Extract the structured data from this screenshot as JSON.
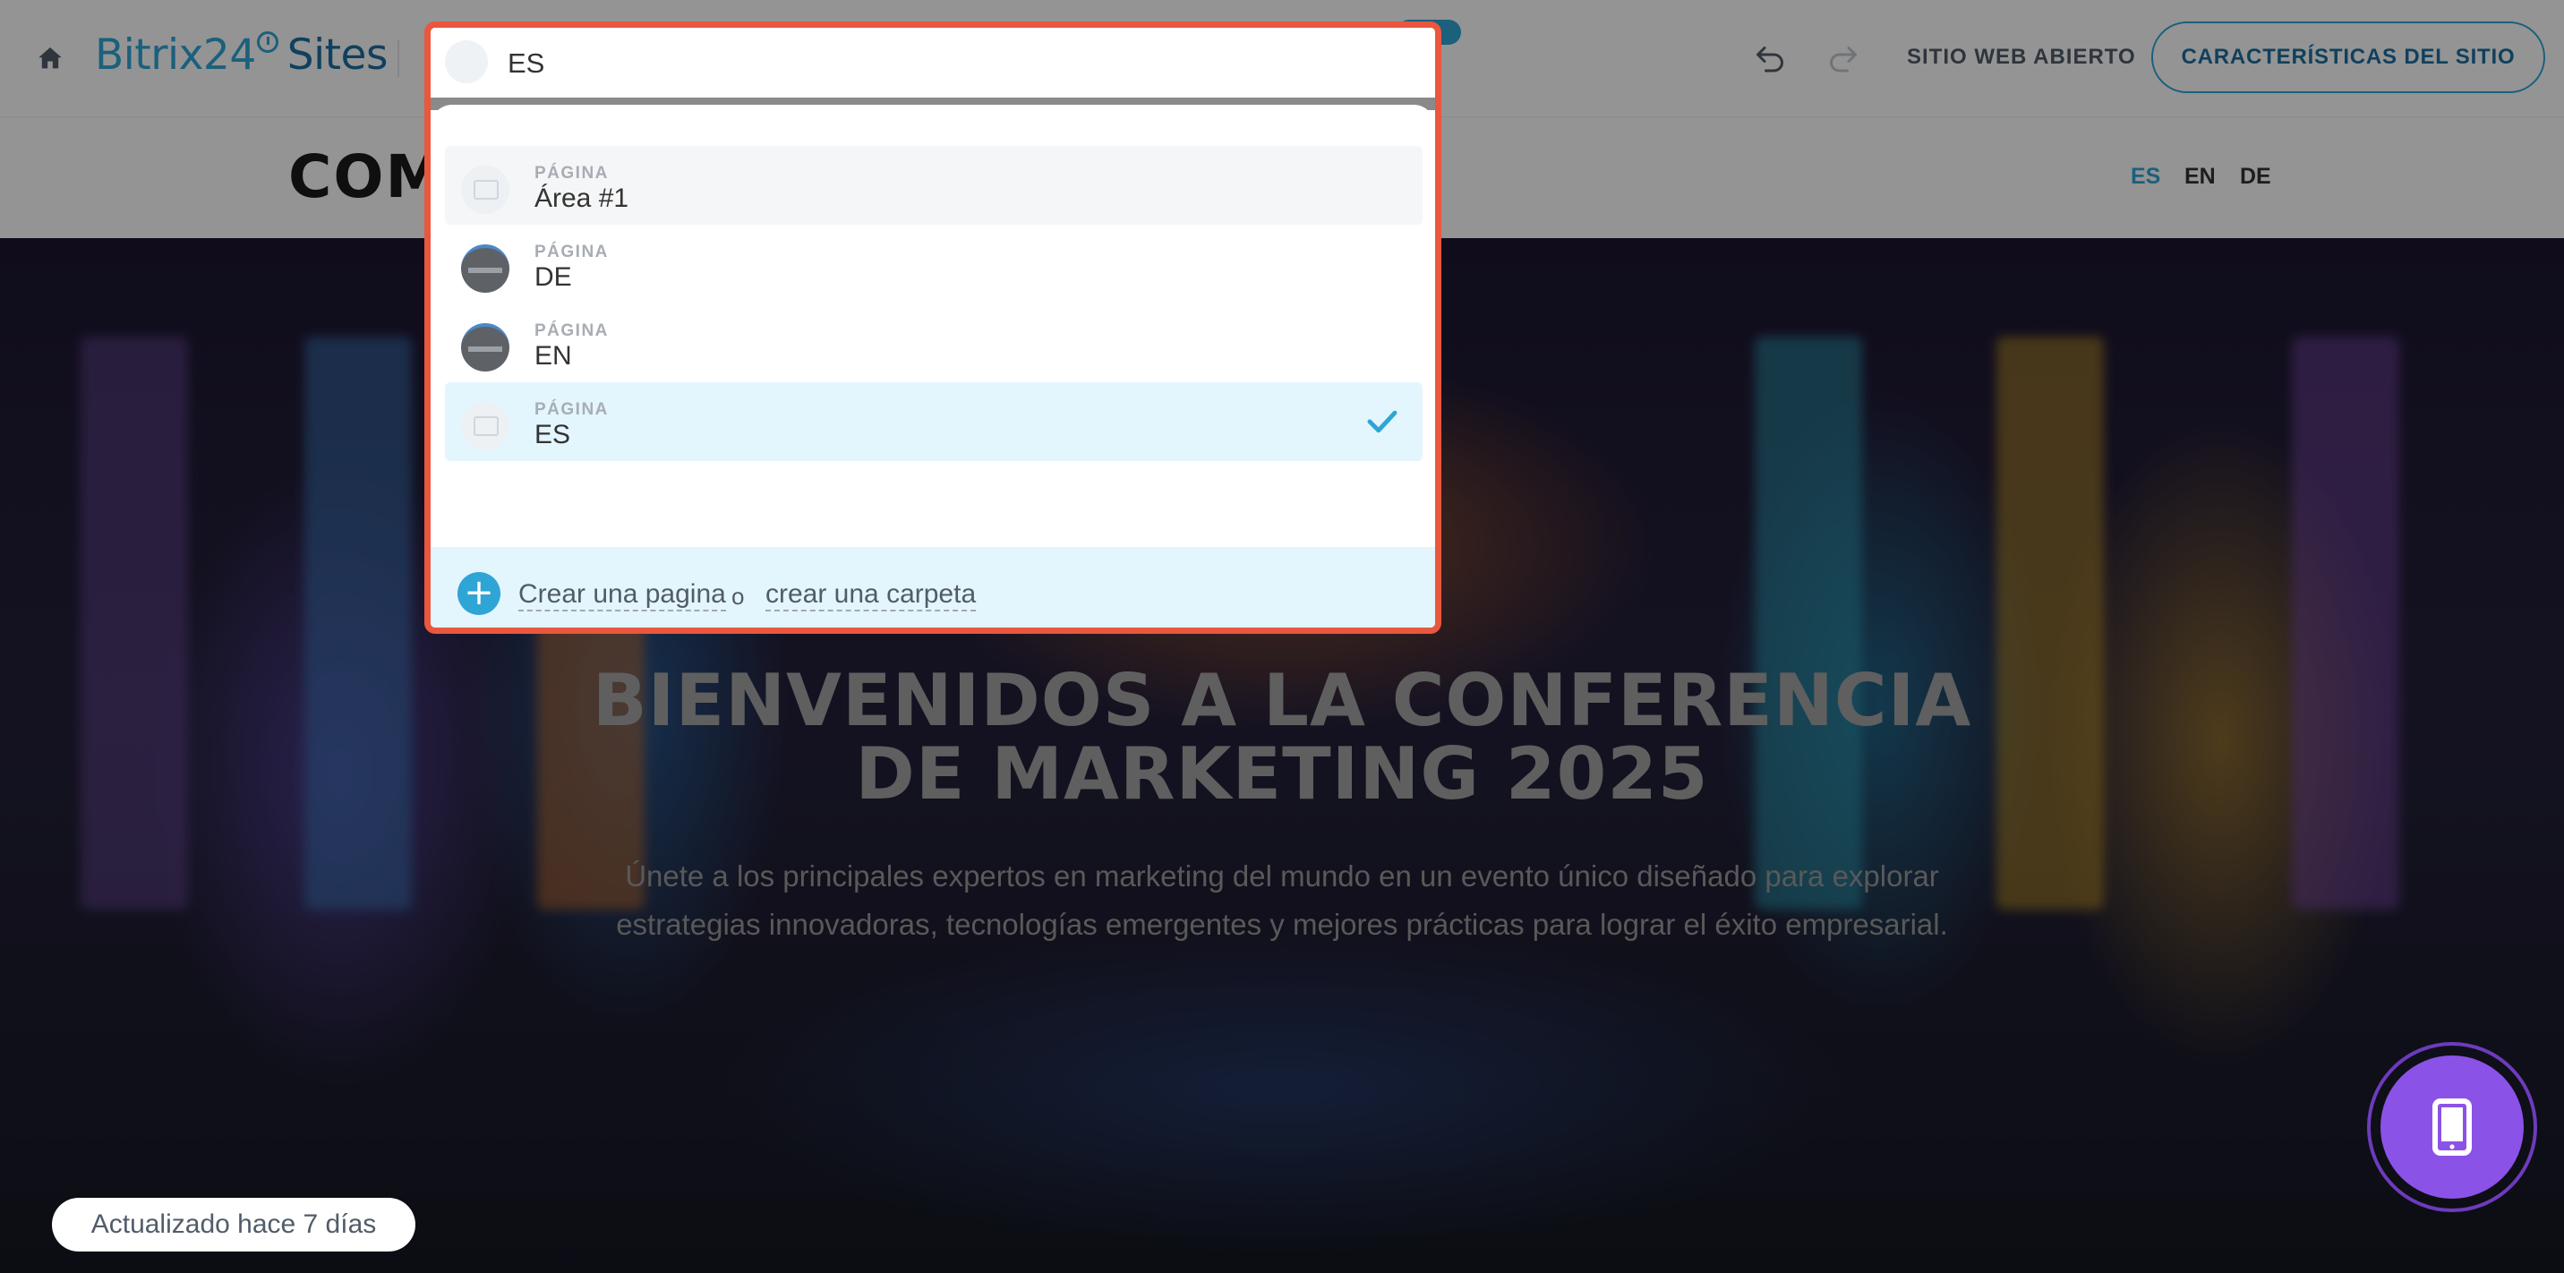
{
  "topbar": {
    "logo_brand": "Bitrix24",
    "logo_product": "Sites",
    "open_site_label": "SITIO WEB ABIERTO",
    "site_settings_label": "CARACTERÍSTICAS DEL SITIO",
    "icons": [
      "home-icon",
      "undo-icon",
      "redo-icon"
    ]
  },
  "site_header": {
    "company_text": "COMP",
    "languages": [
      {
        "code": "ES",
        "active": true
      },
      {
        "code": "EN",
        "active": false
      },
      {
        "code": "DE",
        "active": false
      }
    ]
  },
  "hero": {
    "title_line1": "BIENVENIDOS A LA CONFERENCIA",
    "title_line2": "DE MARKETING 2025",
    "subtitle_line1": "Únete a los principales expertos en marketing del mundo en un evento único diseñado para explorar",
    "subtitle_line2": "estrategias innovadoras, tecnologías emergentes y mejores prácticas para lograr el éxito empresarial."
  },
  "page_switcher": {
    "current_value": "ES",
    "items": [
      {
        "kind": "PÁGINA",
        "name": "Área #1",
        "state": "hover"
      },
      {
        "kind": "PÁGINA",
        "name": "DE",
        "state": "normal"
      },
      {
        "kind": "PÁGINA",
        "name": "EN",
        "state": "normal"
      },
      {
        "kind": "PÁGINA",
        "name": "ES",
        "state": "selected"
      }
    ],
    "create_page_label": "Crear una pagina",
    "or_label": "o",
    "create_folder_label": "crear una carpeta"
  },
  "status": {
    "updated_label": "Actualizado hace 7 días"
  },
  "colors": {
    "accent": "#2fa5d6",
    "popup_border": "#e9573f",
    "selected_bg": "#e3f6fd",
    "device_button": "#8b52e8"
  }
}
